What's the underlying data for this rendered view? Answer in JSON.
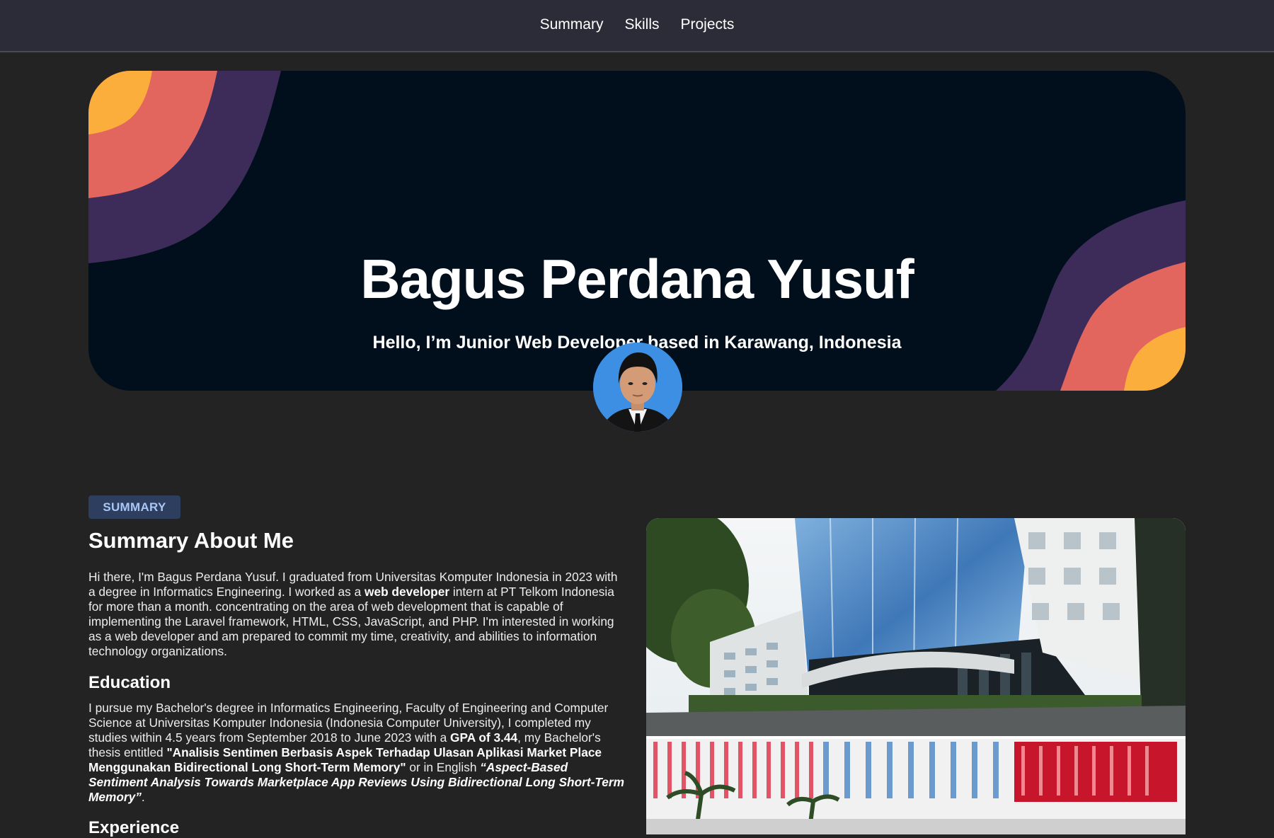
{
  "nav": {
    "items": [
      "Summary",
      "Skills",
      "Projects"
    ]
  },
  "hero": {
    "name": "Bagus Perdana Yusuf",
    "tagline": "Hello, I’m Junior Web Developer based in Karawang, Indonesia",
    "colors": {
      "background": "#010f1c",
      "purple": "#3d2c5a",
      "coral": "#e2665d",
      "orange": "#fcae3c"
    }
  },
  "summary": {
    "badge": "SUMMARY",
    "title": "Summary About Me",
    "intro": {
      "part1": "Hi there, I'm Bagus Perdana Yusuf. I graduated from Universitas Komputer Indonesia in 2023 with a degree in Informatics Engineering. I worked as a ",
      "bold1": "web developer",
      "part2": " intern at PT Telkom Indonesia for more than a month. concentrating on the area of web development that is capable of implementing the Laravel framework, HTML, CSS, JavaScript, and PHP. I'm interested in working as a web developer and am prepared to commit my time, creativity, and abilities to information technology organizations."
    },
    "education": {
      "heading": "Education",
      "part1": "I pursue my Bachelor's degree in Informatics Engineering, Faculty of Engineering and Computer Science at Universitas Komputer Indonesia (Indonesia Computer University), I completed my studies within 4.5 years from September 2018 to June 2023 with a ",
      "gpa": "GPA of 3.44",
      "part2": ", my Bachelor's thesis entitled ",
      "thesis_id": "\"Analisis Sentimen Berbasis Aspek Terhadap Ulasan Aplikasi Market Place Menggunakan Bidirectional Long Short-Term Memory\"",
      "part3": " or in English ",
      "thesis_en": "“Aspect-Based Sentiment Analysis Towards Marketplace App Reviews Using Bidirectional Long Short-Term Memory”",
      "part4": "."
    },
    "experience": {
      "heading": "Experience"
    }
  }
}
